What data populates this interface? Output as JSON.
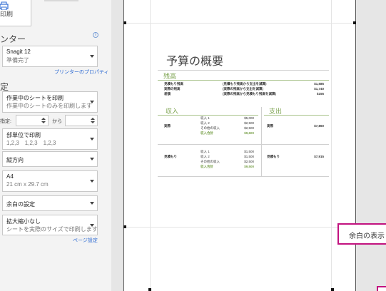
{
  "left_pane": {
    "print_button_label": "印刷",
    "printer_section_title": "ンター",
    "info_icon": "info-icon",
    "printer_name": "Snagit 12",
    "printer_status": "準備完了",
    "printer_properties_link": "プリンターのプロパティ",
    "settings_section_title": "定",
    "sheets_main": "作業中のシートを印刷",
    "sheets_sub": "作業中のシートのみを印刷します",
    "pages_label": "指定:",
    "pages_to_label": "から",
    "collate_main": "部単位で印刷",
    "collate_sub": "1,2,3　1,2,3　1,2,3",
    "orientation": "縦方向",
    "paper_main": "A4",
    "paper_sub": "21 cm x 29.7 cm",
    "margins": "余白の設定",
    "scaling_main": "拡大縮小なし",
    "scaling_sub": "シートを実際のサイズで印刷します",
    "page_setup_link": "ページ設定"
  },
  "preview": {
    "doc_title": "予算の概要",
    "balance_heading": "残高",
    "balance_rows": [
      {
        "label": "見積もり残高",
        "desc": "(見積もり残高から支出を減算)",
        "value": "$1,585"
      },
      {
        "label": "実際の残高",
        "desc": "(実際の残高から支出を減算)",
        "value": "$1,740"
      },
      {
        "label": "差額",
        "desc": "(実際の残高から見積もり残高を減算)",
        "value": "$155"
      }
    ],
    "income_heading": "収入",
    "expense_heading": "支出",
    "income_actual": {
      "label": "実際",
      "rows": [
        {
          "name": "収入 1",
          "value": "$5,000"
        },
        {
          "name": "収入 2",
          "value": "$2,500"
        },
        {
          "name": "その他の収入",
          "value": "$2,500"
        }
      ],
      "total_name": "収入合計",
      "total_value": "$9,600"
    },
    "expense_actual": {
      "label": "実際",
      "value": "$7,860"
    },
    "income_estimate": {
      "label": "見積もり",
      "rows": [
        {
          "name": "収入 1",
          "value": "$1,500"
        },
        {
          "name": "収入 2",
          "value": "$1,500"
        },
        {
          "name": "その他の収入",
          "value": "$2,500"
        }
      ],
      "total_name": "収入合計",
      "total_value": "$9,500"
    },
    "expense_estimate": {
      "label": "見積もり",
      "value": "$7,915"
    }
  },
  "callout": {
    "margins_toggle_label": "余白の表示"
  },
  "colors": {
    "accent_green": "#7ba24d",
    "callout_magenta": "#c2127f",
    "link_blue": "#2e6bd3"
  }
}
